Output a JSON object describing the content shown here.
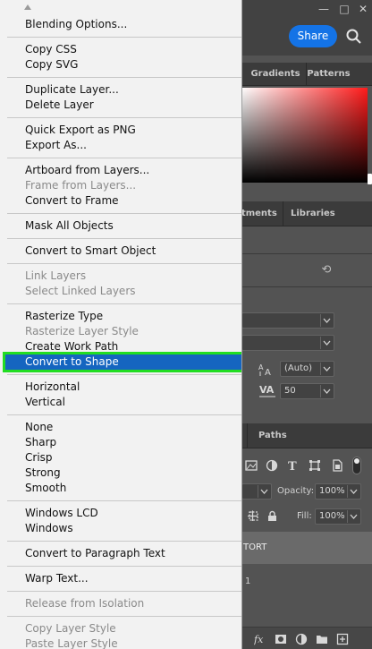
{
  "menu": {
    "items": [
      {
        "label": "Blending Options...",
        "disabled": false
      },
      {
        "label": "Copy CSS",
        "disabled": false
      },
      {
        "label": "Copy SVG",
        "disabled": false
      },
      {
        "label": "Duplicate Layer...",
        "disabled": false
      },
      {
        "label": "Delete Layer",
        "disabled": false
      },
      {
        "label": "Quick Export as PNG",
        "disabled": false
      },
      {
        "label": "Export As...",
        "disabled": false
      },
      {
        "label": "Artboard from Layers...",
        "disabled": false
      },
      {
        "label": "Frame from Layers...",
        "disabled": true
      },
      {
        "label": "Convert to Frame",
        "disabled": false
      },
      {
        "label": "Mask All Objects",
        "disabled": false
      },
      {
        "label": "Convert to Smart Object",
        "disabled": false
      },
      {
        "label": "Link Layers",
        "disabled": true
      },
      {
        "label": "Select Linked Layers",
        "disabled": true
      },
      {
        "label": "Rasterize Type",
        "disabled": false
      },
      {
        "label": "Rasterize Layer Style",
        "disabled": true
      },
      {
        "label": "Create Work Path",
        "disabled": false
      },
      {
        "label": "Convert to Shape",
        "disabled": false,
        "highlighted": true
      },
      {
        "label": "Horizontal",
        "disabled": false
      },
      {
        "label": "Vertical",
        "disabled": false
      },
      {
        "label": "None",
        "disabled": false
      },
      {
        "label": "Sharp",
        "disabled": false
      },
      {
        "label": "Crisp",
        "disabled": false
      },
      {
        "label": "Strong",
        "disabled": false
      },
      {
        "label": "Smooth",
        "disabled": false
      },
      {
        "label": "Windows LCD",
        "disabled": false
      },
      {
        "label": "Windows",
        "disabled": false
      },
      {
        "label": "Convert to Paragraph Text",
        "disabled": false
      },
      {
        "label": "Warp Text...",
        "disabled": false
      },
      {
        "label": "Release from Isolation",
        "disabled": true
      },
      {
        "label": "Copy Layer Style",
        "disabled": true
      },
      {
        "label": "Paste Layer Style",
        "disabled": true
      }
    ]
  },
  "header": {
    "share_label": "Share"
  },
  "color_panel": {
    "tabs": [
      "Gradients",
      "Patterns"
    ]
  },
  "adjust_panel": {
    "tabs": [
      "stments",
      "Libraries"
    ]
  },
  "character": {
    "leading": "(Auto)",
    "tracking": "50"
  },
  "layers_panel": {
    "tab": "Paths",
    "opacity_label": "Opacity:",
    "opacity_value": "100%",
    "fill_label": "Fill:",
    "fill_value": "100%",
    "layer_name": "TORT",
    "layer_number": "1"
  },
  "colors": {
    "menu_highlight": "#1565c0",
    "highlight_outline": "#22dd22",
    "share_button": "#1473e6",
    "color_field_hue": "#ff1a1a"
  }
}
